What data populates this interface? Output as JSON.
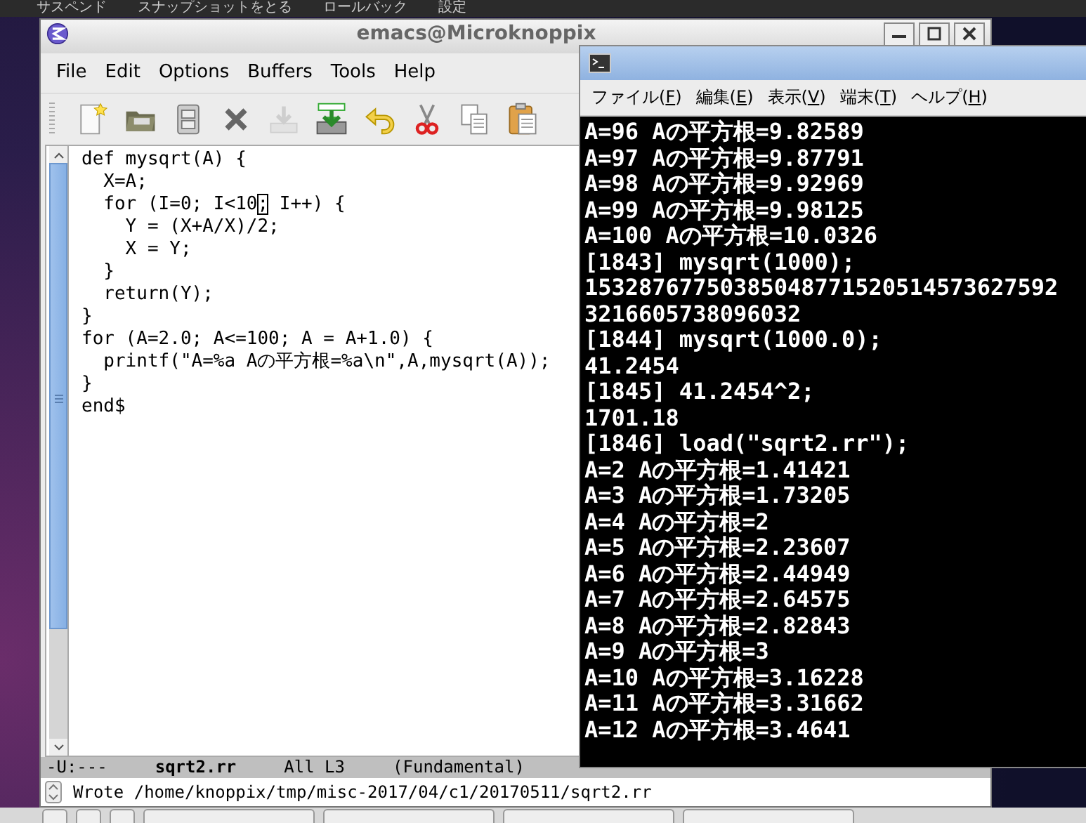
{
  "desktop_top_bar": {
    "items": [
      "サスペンド",
      "スナップショットをとる",
      "ロールバック",
      "設定"
    ]
  },
  "emacs_window": {
    "title": "emacs@Microknoppix",
    "menu": [
      "File",
      "Edit",
      "Options",
      "Buffers",
      "Tools",
      "Help"
    ],
    "toolbar": [
      {
        "kind": "new",
        "disabled": false
      },
      {
        "kind": "open",
        "disabled": false
      },
      {
        "kind": "save",
        "disabled": false
      },
      {
        "kind": "close",
        "disabled": false
      },
      {
        "kind": "download",
        "disabled": true
      },
      {
        "kind": "save-as",
        "disabled": false
      },
      {
        "kind": "undo",
        "disabled": false
      },
      {
        "kind": "cut",
        "disabled": false
      },
      {
        "kind": "copy",
        "disabled": false
      },
      {
        "kind": "paste",
        "disabled": false
      }
    ],
    "editor": {
      "lines": [
        {
          "text": "def mysqrt(A) {"
        },
        {
          "text": "  X=A;"
        },
        {
          "text": "  for (I=0; I<10",
          "cursor": ";",
          "rest": " I++) {"
        },
        {
          "text": "    Y = (X+A/X)/2;"
        },
        {
          "text": "    X = Y;"
        },
        {
          "text": "  }"
        },
        {
          "text": "  return(Y);"
        },
        {
          "text": "}"
        },
        {
          "text": "for (A=2.0; A<=100; A = A+1.0) {"
        },
        {
          "text": "  printf(\"A=%a Aの平方根=%a\\n\",A,mysqrt(A));"
        },
        {
          "text": "}"
        },
        {
          "text": "end$"
        }
      ]
    },
    "mode_line": {
      "status": "-U:---",
      "buffer": "sqrt2.rr",
      "position": "All L3",
      "mode": "(Fundamental)"
    },
    "minibuffer": "Wrote /home/knoppix/tmp/misc-2017/04/c1/20170511/sqrt2.rr"
  },
  "terminal_window": {
    "menu": [
      "ファイル(F)",
      "編集(E)",
      "表示(V)",
      "端末(T)",
      "ヘルプ(H)"
    ],
    "lines": [
      "A=96 Aの平方根=9.82589",
      "A=97 Aの平方根=9.87791",
      "A=98 Aの平方根=9.92969",
      "A=99 Aの平方根=9.98125",
      "A=100 Aの平方根=10.0326",
      "[1843] mysqrt(1000);",
      "15328767750385048771520514573627592",
      "3216605738096032",
      "[1844] mysqrt(1000.0);",
      "41.2454",
      "[1845] 41.2454^2;",
      "1701.18",
      "[1846] load(\"sqrt2.rr\");",
      "A=2 Aの平方根=1.41421",
      "A=3 Aの平方根=1.73205",
      "A=4 Aの平方根=2",
      "A=5 Aの平方根=2.23607",
      "A=6 Aの平方根=2.44949",
      "A=7 Aの平方根=2.64575",
      "A=8 Aの平方根=2.82843",
      "A=9 Aの平方根=3",
      "A=10 Aの平方根=3.16228",
      "A=11 Aの平方根=3.31662",
      "A=12 Aの平方根=3.4641"
    ]
  }
}
